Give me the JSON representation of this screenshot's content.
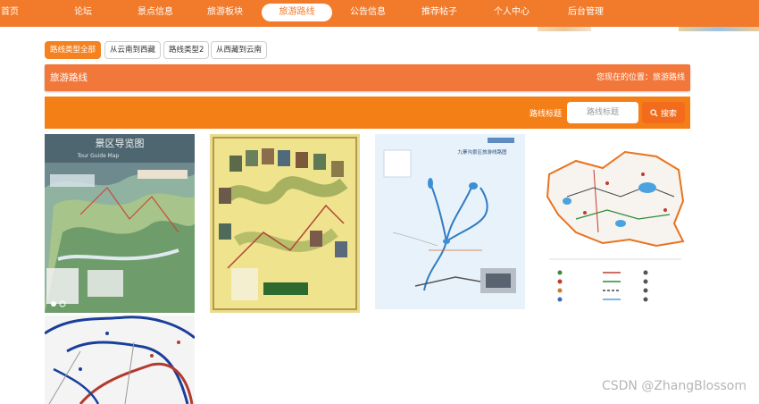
{
  "nav": {
    "items": [
      {
        "label": "首页"
      },
      {
        "label": "论坛"
      },
      {
        "label": "景点信息"
      },
      {
        "label": "旅游板块"
      },
      {
        "label": "旅游路线"
      },
      {
        "label": "公告信息"
      },
      {
        "label": "推荐帖子"
      },
      {
        "label": "个人中心"
      },
      {
        "label": "后台管理"
      }
    ],
    "active": "旅游路线",
    "bg_color": "#f27a2b"
  },
  "filters": [
    {
      "label": "路线类型全部",
      "active": true
    },
    {
      "label": "从云南到西藏",
      "active": false
    },
    {
      "label": "路线类型2",
      "active": false
    },
    {
      "label": "从西藏到云南",
      "active": false
    }
  ],
  "header": {
    "title": "旅游路线",
    "location": "您现在的位置：旅游路线"
  },
  "search": {
    "label": "路线标题",
    "placeholder": "路线标题",
    "value": "",
    "button_label": "搜索",
    "button_icon": "search-icon"
  },
  "cards": [
    {
      "image": "scenic-area-guide-map",
      "map_title": "景区导览图",
      "map_subtitle": "Tour Guide Map"
    },
    {
      "image": "scenic-spots-illustrated-map"
    },
    {
      "image": "jiuzhaigou-route-map",
      "map_title": "九寨沟景区旅游线路图"
    },
    {
      "image": "province-route-map"
    },
    {
      "image": "road-network-map"
    }
  ],
  "watermark": "CSDN @ZhangBlossom",
  "colors": {
    "accent": "#f58220",
    "title_bar": "#f2773a",
    "search_bar": "#f57f17"
  }
}
